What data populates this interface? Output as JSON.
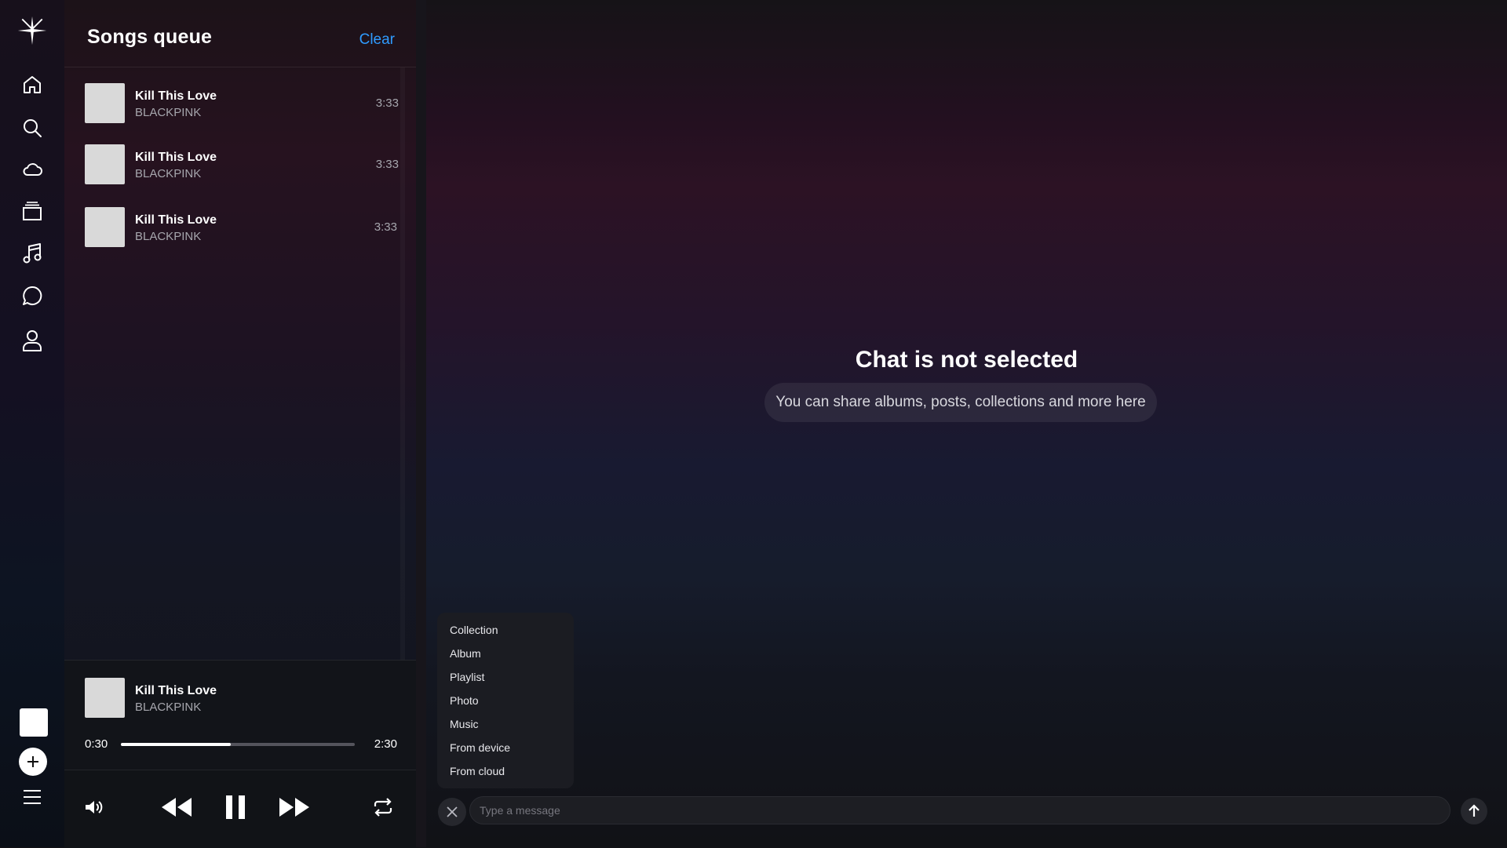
{
  "queue": {
    "title": "Songs queue",
    "clear_label": "Clear",
    "songs": [
      {
        "title": "Kill This Love",
        "artist": "BLACKPINK",
        "duration": "3:33"
      },
      {
        "title": "Kill This Love",
        "artist": "BLACKPINK",
        "duration": "3:33"
      },
      {
        "title": "Kill This Love",
        "artist": "BLACKPINK",
        "duration": "3:33"
      }
    ]
  },
  "now_playing": {
    "title": "Kill This Love",
    "artist": "BLACKPINK",
    "current_time": "0:30",
    "end_time": "2:30",
    "progress_fraction": 0.47
  },
  "sidebar": {
    "icons": [
      "logo-icon",
      "home-icon",
      "search-icon",
      "cloud-icon",
      "collections-icon",
      "music-note-icon",
      "chat-icon",
      "user-icon",
      "add-icon",
      "menu-icon"
    ]
  },
  "chat": {
    "empty_title": "Chat is not selected",
    "empty_subtitle": "You can share albums, posts, collections and more here",
    "attach_menu": [
      "Collection",
      "Album",
      "Playlist",
      "Photo",
      "Music",
      "From device",
      "From cloud"
    ],
    "input_placeholder": "Type a message"
  },
  "colors": {
    "accent": "#2f9bff",
    "thumb_placeholder": "#d9d9d9"
  }
}
